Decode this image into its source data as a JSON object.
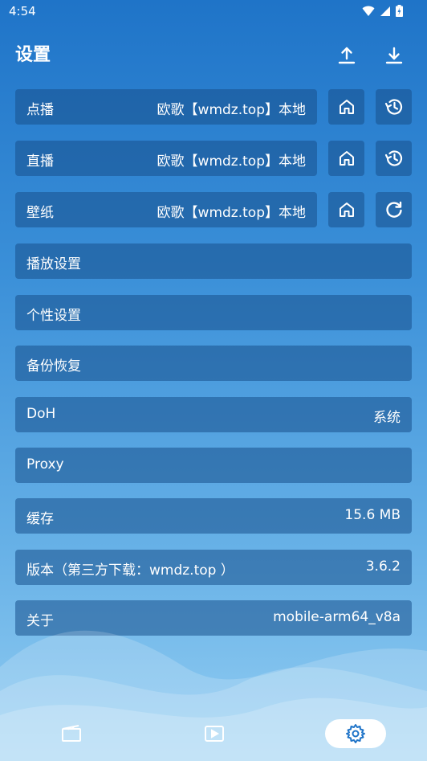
{
  "status": {
    "time": "4:54"
  },
  "header": {
    "title": "设置",
    "upload_icon": "upload-icon",
    "download_icon": "download-icon"
  },
  "source_rows": [
    {
      "label": "点播",
      "value": "欧歌【wmdz.top】本地",
      "action_icon": "history-icon"
    },
    {
      "label": "直播",
      "value": "欧歌【wmdz.top】本地",
      "action_icon": "history-icon"
    },
    {
      "label": "壁纸",
      "value": "欧歌【wmdz.top】本地",
      "action_icon": "refresh-icon"
    }
  ],
  "settings_rows": [
    {
      "label": "播放设置",
      "value": ""
    },
    {
      "label": "个性设置",
      "value": ""
    },
    {
      "label": "备份恢复",
      "value": ""
    },
    {
      "label": "DoH",
      "value": "系统"
    },
    {
      "label": "Proxy",
      "value": ""
    },
    {
      "label": "缓存",
      "value": "15.6 MB"
    },
    {
      "label": "版本（第三方下载：wmdz.top ）",
      "value": "3.6.2"
    },
    {
      "label": "关于",
      "value": "mobile-arm64_v8a"
    }
  ],
  "bottom_nav": [
    {
      "icon": "film-icon",
      "active": false
    },
    {
      "icon": "live-icon",
      "active": false
    },
    {
      "icon": "gear-icon",
      "active": true
    }
  ],
  "colors": {
    "accent": "#1f74c8",
    "row_bg": "#2f6fb1",
    "active_nav_bg": "#ffffff"
  }
}
